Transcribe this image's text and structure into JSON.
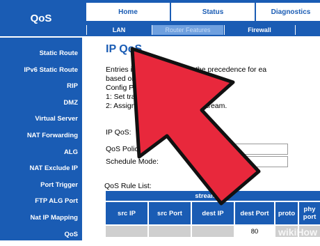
{
  "brand": "QoS",
  "topnav": {
    "home": "Home",
    "status": "Status",
    "diagnostics": "Diagnostics"
  },
  "subnav": {
    "lan": "LAN",
    "router_features": "Router Features",
    "firewall": "Firewall"
  },
  "sidebar": {
    "items": [
      {
        "label": "Static Route"
      },
      {
        "label": "IPv6 Static Route"
      },
      {
        "label": "RIP"
      },
      {
        "label": "DMZ"
      },
      {
        "label": "Virtual Server"
      },
      {
        "label": "NAT Forwarding"
      },
      {
        "label": "ALG"
      },
      {
        "label": "NAT Exclude IP"
      },
      {
        "label": "Port Trigger"
      },
      {
        "label": "FTP ALG Port"
      },
      {
        "label": "Nat IP Mapping"
      },
      {
        "label": "QoS"
      }
    ]
  },
  "main": {
    "title": "IP QoS",
    "intro_lines": [
      "Entries in ... used to assign the precedence for ea",
      "based on s",
      "Config Proc",
      "1: Set traffic",
      "2: Assign the p ... for different stream."
    ],
    "ip_qos_label": "IP QoS:",
    "qos_policy_label": "QoS Policy:",
    "qos_policy_value": "stream",
    "schedule_mode_label": "Schedule Mode:",
    "schedule_mode_value": "strict prior",
    "rule_list_label": "QoS Rule List:"
  },
  "rule_table": {
    "group_header": "stream rule",
    "columns": [
      "src IP",
      "src Port",
      "dest IP",
      "dest Port",
      "proto",
      "phy port"
    ],
    "rows": [
      [
        "",
        "",
        "",
        "80",
        "",
        ""
      ]
    ]
  },
  "watermark": "wikiHow",
  "colors": {
    "nav_blue": "#1a5cb4",
    "arrow_red": "#e8283c"
  }
}
